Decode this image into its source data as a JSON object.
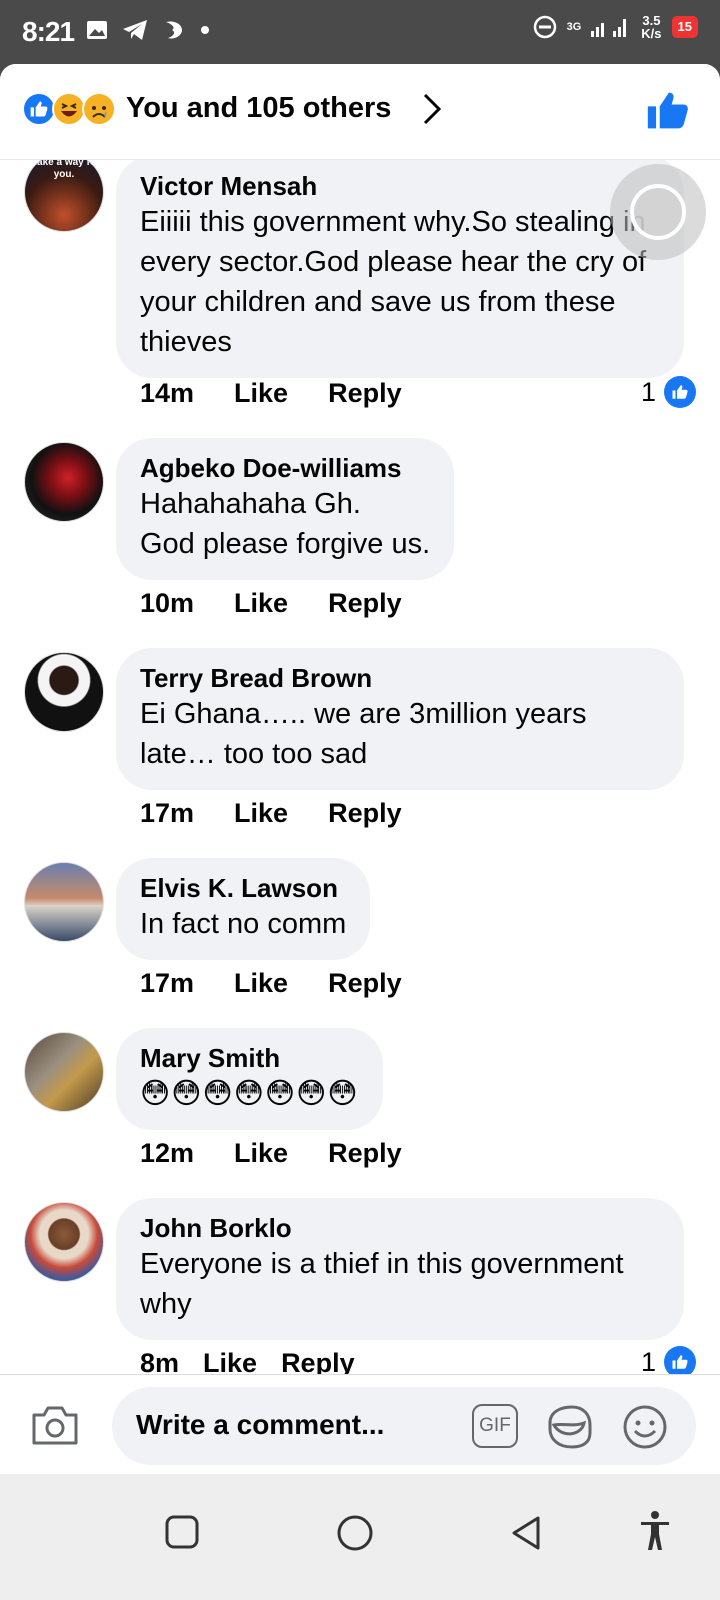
{
  "status_bar": {
    "time": "8:21",
    "network": "3G",
    "speed_value": "3.5",
    "speed_unit": "K/s",
    "battery": "15"
  },
  "header": {
    "title": "You and 105 others",
    "reactions": [
      "like",
      "haha",
      "sad"
    ]
  },
  "comments": [
    {
      "author": "Victor Mensah",
      "text": "Eiiiii this government why.So stealing in every sector.God please hear the cry of your children and save us from these thieves",
      "time": "14m",
      "like_label": "Like",
      "reply_label": "Reply",
      "likes": "1",
      "avatar_caption": "make a way for you."
    },
    {
      "author": "Agbeko Doe-williams",
      "text": "Hahahahaha Gh.\nGod please forgive us.",
      "time": "10m",
      "like_label": "Like",
      "reply_label": "Reply",
      "likes": ""
    },
    {
      "author": "Terry Bread Brown",
      "text": "Ei Ghana….. we are 3million years late… too too sad",
      "time": "17m",
      "like_label": "Like",
      "reply_label": "Reply",
      "likes": ""
    },
    {
      "author": "Elvis K. Lawson",
      "text": "In fact no comm",
      "time": "17m",
      "like_label": "Like",
      "reply_label": "Reply",
      "likes": ""
    },
    {
      "author": "Mary Smith",
      "text": "😳😳😳😳😳😳😳",
      "time": "12m",
      "like_label": "Like",
      "reply_label": "Reply",
      "likes": ""
    },
    {
      "author": "John Borklo",
      "text": "Everyone is a thief in this government why",
      "time": "8m",
      "like_label": "Like",
      "reply_label": "Reply",
      "likes": "1"
    }
  ],
  "composer": {
    "placeholder": "Write a comment...",
    "gif_label": "GIF"
  },
  "colors": {
    "accent": "#1877f2",
    "bubble": "#f0f2f5",
    "statusbar": "#4a4a4a"
  }
}
